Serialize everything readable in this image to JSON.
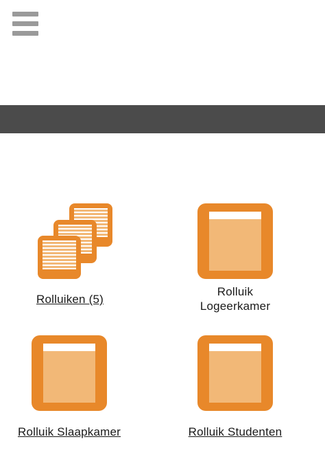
{
  "menu": {
    "icon": "hamburger-menu-icon"
  },
  "tiles": [
    {
      "label": "Rolluiken (5)",
      "linked": true,
      "icon": "shutter-group-icon"
    },
    {
      "label": "Rolluik Logeerkamer",
      "linked": false,
      "icon": "shutter-icon"
    },
    {
      "label": "Rolluik Slaapkamer",
      "linked": true,
      "icon": "shutter-icon"
    },
    {
      "label": "Rolluik Studenten",
      "linked": true,
      "icon": "shutter-icon"
    }
  ],
  "colors": {
    "accent": "#e8882a",
    "accent_light": "#f2b877",
    "title_bar": "#4b4b4b",
    "menu_icon": "#9a9a9a"
  }
}
